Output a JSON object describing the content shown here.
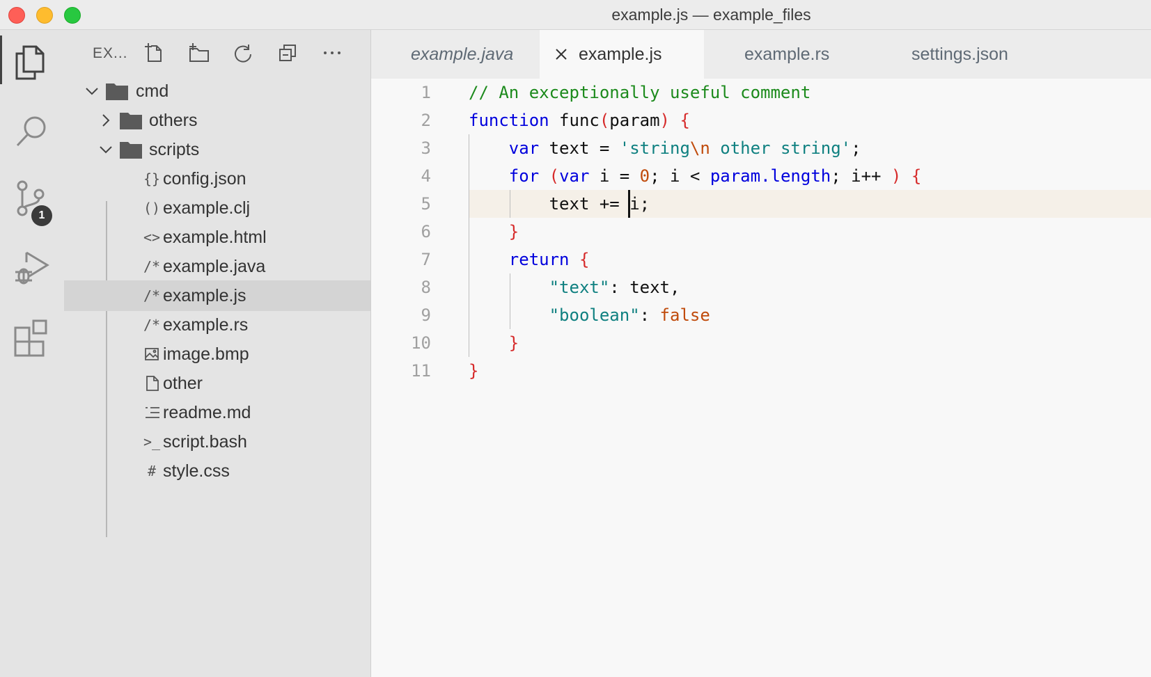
{
  "window": {
    "title": "example.js — example_files"
  },
  "activity_bar": {
    "items": [
      {
        "name": "explorer",
        "icon": "files-icon"
      },
      {
        "name": "search",
        "icon": "search-icon"
      },
      {
        "name": "source-control",
        "icon": "source-control-icon",
        "badge": "1"
      },
      {
        "name": "run-debug",
        "icon": "run-debug-icon"
      },
      {
        "name": "extensions",
        "icon": "extensions-icon"
      }
    ]
  },
  "sidebar": {
    "title": "EX...",
    "actions": [
      "new-file-icon",
      "new-folder-icon",
      "refresh-icon",
      "collapse-all-icon",
      "more-icon"
    ],
    "tree": [
      {
        "label": "cmd",
        "type": "folder",
        "expanded": true
      },
      {
        "label": "others",
        "type": "folder",
        "expanded": false
      },
      {
        "label": "scripts",
        "type": "folder",
        "expanded": true
      },
      {
        "label": "config.json",
        "glyph": "{}"
      },
      {
        "label": "example.clj",
        "glyph": "()"
      },
      {
        "label": "example.html",
        "glyph": "<>"
      },
      {
        "label": "example.java",
        "glyph": "/*"
      },
      {
        "label": "example.js",
        "glyph": "/*",
        "selected": true
      },
      {
        "label": "example.rs",
        "glyph": "/*"
      },
      {
        "label": "image.bmp",
        "glyph": "image-icon"
      },
      {
        "label": "other",
        "glyph": "file-icon"
      },
      {
        "label": "readme.md",
        "glyph": "list-icon"
      },
      {
        "label": "script.bash",
        "glyph": ">_"
      },
      {
        "label": "style.css",
        "glyph": "#"
      }
    ]
  },
  "tabs": [
    {
      "label": "example.java",
      "state": "preview"
    },
    {
      "label": "example.js",
      "state": "active"
    },
    {
      "label": "example.rs",
      "state": "inactive"
    },
    {
      "label": "settings.json",
      "state": "inactive"
    }
  ],
  "editor": {
    "line_numbers": [
      "1",
      "2",
      "3",
      "4",
      "5",
      "6",
      "7",
      "8",
      "9",
      "10",
      "11"
    ],
    "current_line": 5,
    "lines": [
      "// An exceptionally useful comment",
      "function func(param) {",
      "    var text = 'string\\n other string';",
      "    for (var i = 0; i < param.length; i++ ) {",
      "        text += i;",
      "    }",
      "    return {",
      "        \"text\": text,",
      "        \"boolean\": false",
      "    }",
      "}"
    ]
  },
  "colors": {
    "comment": "#1c8a1c",
    "keyword": "#0000dd",
    "string": "#0f8080",
    "number": "#c04b0c",
    "bracket": "#d62a2a"
  }
}
